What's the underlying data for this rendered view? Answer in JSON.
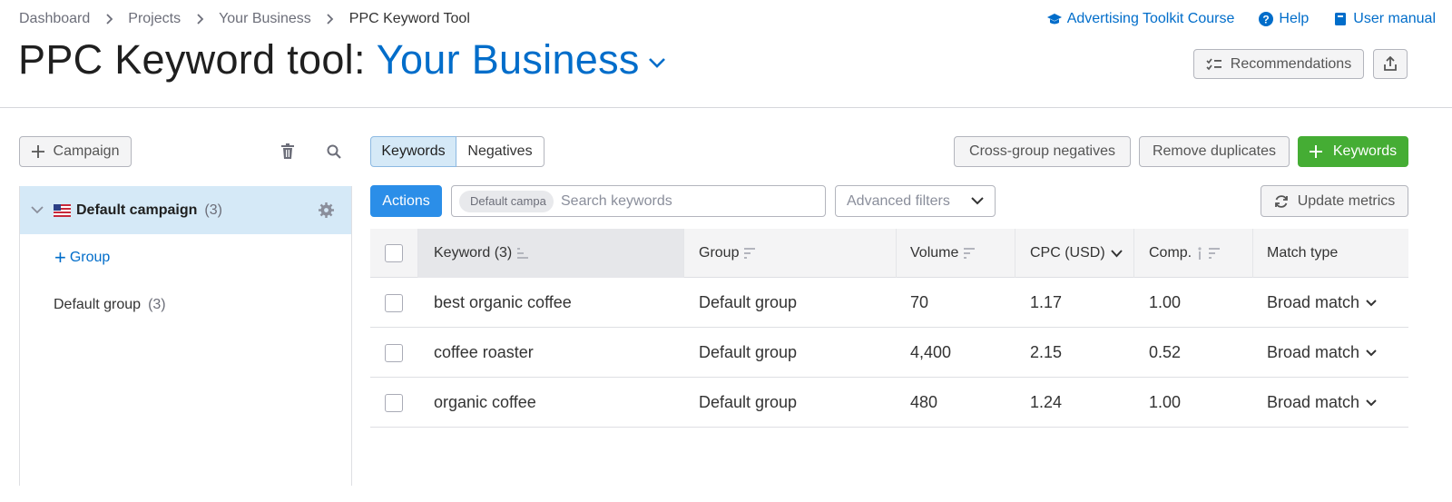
{
  "breadcrumb": [
    "Dashboard",
    "Projects",
    "Your Business",
    "PPC Keyword Tool"
  ],
  "top_links": {
    "course": "Advertising Toolkit Course",
    "help": "Help",
    "manual": "User manual"
  },
  "title": {
    "prefix": "PPC Keyword tool:",
    "project": "Your Business"
  },
  "header_buttons": {
    "recommendations": "Recommendations"
  },
  "sidebar": {
    "add_campaign": "Campaign",
    "campaign_name": "Default campaign",
    "campaign_count": "(3)",
    "add_group": "Group",
    "group_name": "Default group",
    "group_count": "(3)"
  },
  "tabs": [
    "Keywords",
    "Negatives"
  ],
  "toolbar": {
    "cross_group": "Cross-group negatives",
    "remove_duplicates": "Remove duplicates",
    "add_keywords": "Keywords",
    "actions": "Actions",
    "search_tag": "Default campa",
    "search_placeholder": "Search keywords",
    "advanced_filters": "Advanced filters",
    "update_metrics": "Update metrics"
  },
  "table": {
    "columns": [
      "Keyword (3)",
      "Group",
      "Volume",
      "CPC (USD)",
      "Comp.",
      "Match type"
    ],
    "rows": [
      {
        "keyword": "best organic coffee",
        "group": "Default group",
        "volume": "70",
        "cpc": "1.17",
        "comp": "1.00",
        "match": "Broad match"
      },
      {
        "keyword": "coffee roaster",
        "group": "Default group",
        "volume": "4,400",
        "cpc": "2.15",
        "comp": "0.52",
        "match": "Broad match"
      },
      {
        "keyword": "organic coffee",
        "group": "Default group",
        "volume": "480",
        "cpc": "1.24",
        "comp": "1.00",
        "match": "Broad match"
      }
    ]
  },
  "colors": {
    "accent": "#006dca",
    "primary_button": "#2b8ee8",
    "success_button": "#45ad34",
    "selected_row": "#d5e9f7"
  }
}
